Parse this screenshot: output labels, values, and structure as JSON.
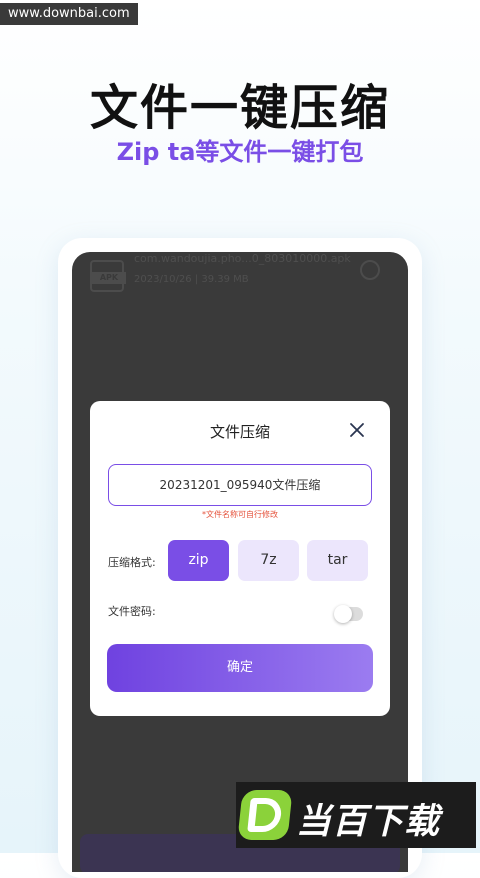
{
  "watermark": {
    "text": "www.downbai.com"
  },
  "promo": {
    "headline": "文件一键压缩",
    "subline": "Zip ta等文件一键打包"
  },
  "background_file": {
    "badge": "APK",
    "name": "com.wandoujia.pho...0_803010000.apk",
    "meta": "2023/10/26 | 39.39 MB"
  },
  "dialog": {
    "title": "文件压缩",
    "filename_value": "20231201_095940文件压缩",
    "filename_hint": "*文件名称可自行修改",
    "format_label": "压缩格式:",
    "formats": [
      "zip",
      "7z",
      "tar"
    ],
    "selected_format": "zip",
    "password_label": "文件密码:",
    "password_enabled": false,
    "confirm_label": "确定"
  },
  "logo": {
    "letter": "D",
    "text": "当百下载"
  },
  "colors": {
    "accent": "#7a4ee6",
    "accent_light": "#ece6fc",
    "hint_red": "#e5533c",
    "overlay": "#3a3a3a",
    "logo_green": "#8bd23a"
  }
}
